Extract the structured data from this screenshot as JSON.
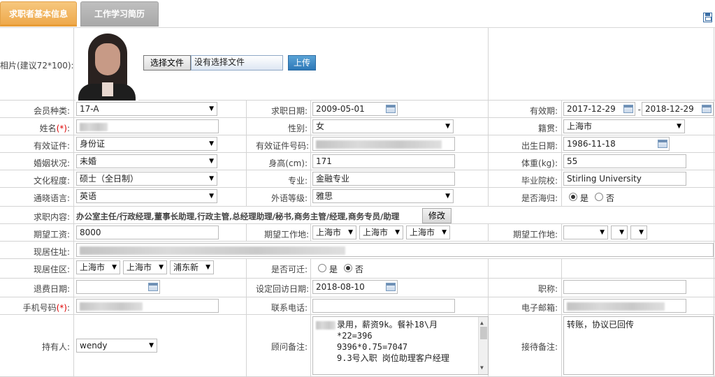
{
  "tabs": {
    "active": "求职者基本信息",
    "inactive": "工作学习简历"
  },
  "photo": {
    "label": "相片(建议72*100):",
    "choose_btn": "选择文件",
    "no_file": "没有选择文件",
    "upload_btn": "上传"
  },
  "row1": {
    "member_label": "会员种类:",
    "member_value": "17-A",
    "apply_label": "求职日期:",
    "apply_value": "2009-05-01",
    "valid_label": "有效期:",
    "valid_from": "2017-12-29",
    "valid_sep": "-",
    "valid_to": "2018-12-29"
  },
  "row2": {
    "name_label": "姓名",
    "gender_label": "性别:",
    "gender_value": "女",
    "native_label": "籍贯:",
    "native_value": "上海市"
  },
  "row3": {
    "idtype_label": "有效证件:",
    "idtype_value": "身份证",
    "idno_label": "有效证件号码:",
    "birth_label": "出生日期:",
    "birth_value": "1986-11-18"
  },
  "row4": {
    "marital_label": "婚姻状况:",
    "marital_value": "未婚",
    "height_label": "身高(cm):",
    "height_value": "171",
    "weight_label": "体重(kg):",
    "weight_value": "55"
  },
  "row5": {
    "edu_label": "文化程度:",
    "edu_value": "硕士（全日制）",
    "major_label": "专业:",
    "major_value": "金融专业",
    "school_label": "毕业院校:",
    "school_value": "Stirling University"
  },
  "row6": {
    "lang_label": "通晓语言:",
    "lang_value": "英语",
    "level_label": "外语等级:",
    "level_value": "雅思",
    "returnee_label": "是否海归:",
    "yes": "是",
    "no": "否"
  },
  "row7": {
    "job_label": "求职内容:",
    "job_value": "办公室主任/行政经理,董事长助理,行政主管,总经理助理/秘书,商务主管/经理,商务专员/助理",
    "edit_btn": "修改"
  },
  "row8": {
    "salary_label": "期望工资:",
    "salary_value": "8000",
    "loc1_label": "期望工作地:",
    "loc1_a": "上海市",
    "loc1_b": "上海市",
    "loc1_c": "上海市",
    "loc2_label": "期望工作地:"
  },
  "row9": {
    "addr_label": "现居住址:"
  },
  "row10": {
    "area_label": "现居住区:",
    "area_a": "上海市",
    "area_b": "上海市",
    "area_c": "浦东新",
    "move_label": "是否可迁:",
    "yes": "是",
    "no": "否"
  },
  "row11": {
    "refund_label": "退费日期:",
    "visit_label": "设定回访日期:",
    "visit_value": "2018-08-10",
    "title_label": "职称:"
  },
  "row12": {
    "mobile_label": "手机号码",
    "phone_label": "联系电话:",
    "email_label": "电子邮箱:"
  },
  "row13": {
    "holder_label": "持有人:",
    "holder_value": "wendy",
    "advisor_label": "顾问备注:",
    "advisor_text": "录用，薪资9k。餐补18\\月\n*22=396\n9396*0.75=7047\n9.3号入职 岗位助理客户经理",
    "reception_label": "接待备注:",
    "reception_text": "转账，协议已回传"
  },
  "req_mark": "(*)",
  "colon": ":"
}
